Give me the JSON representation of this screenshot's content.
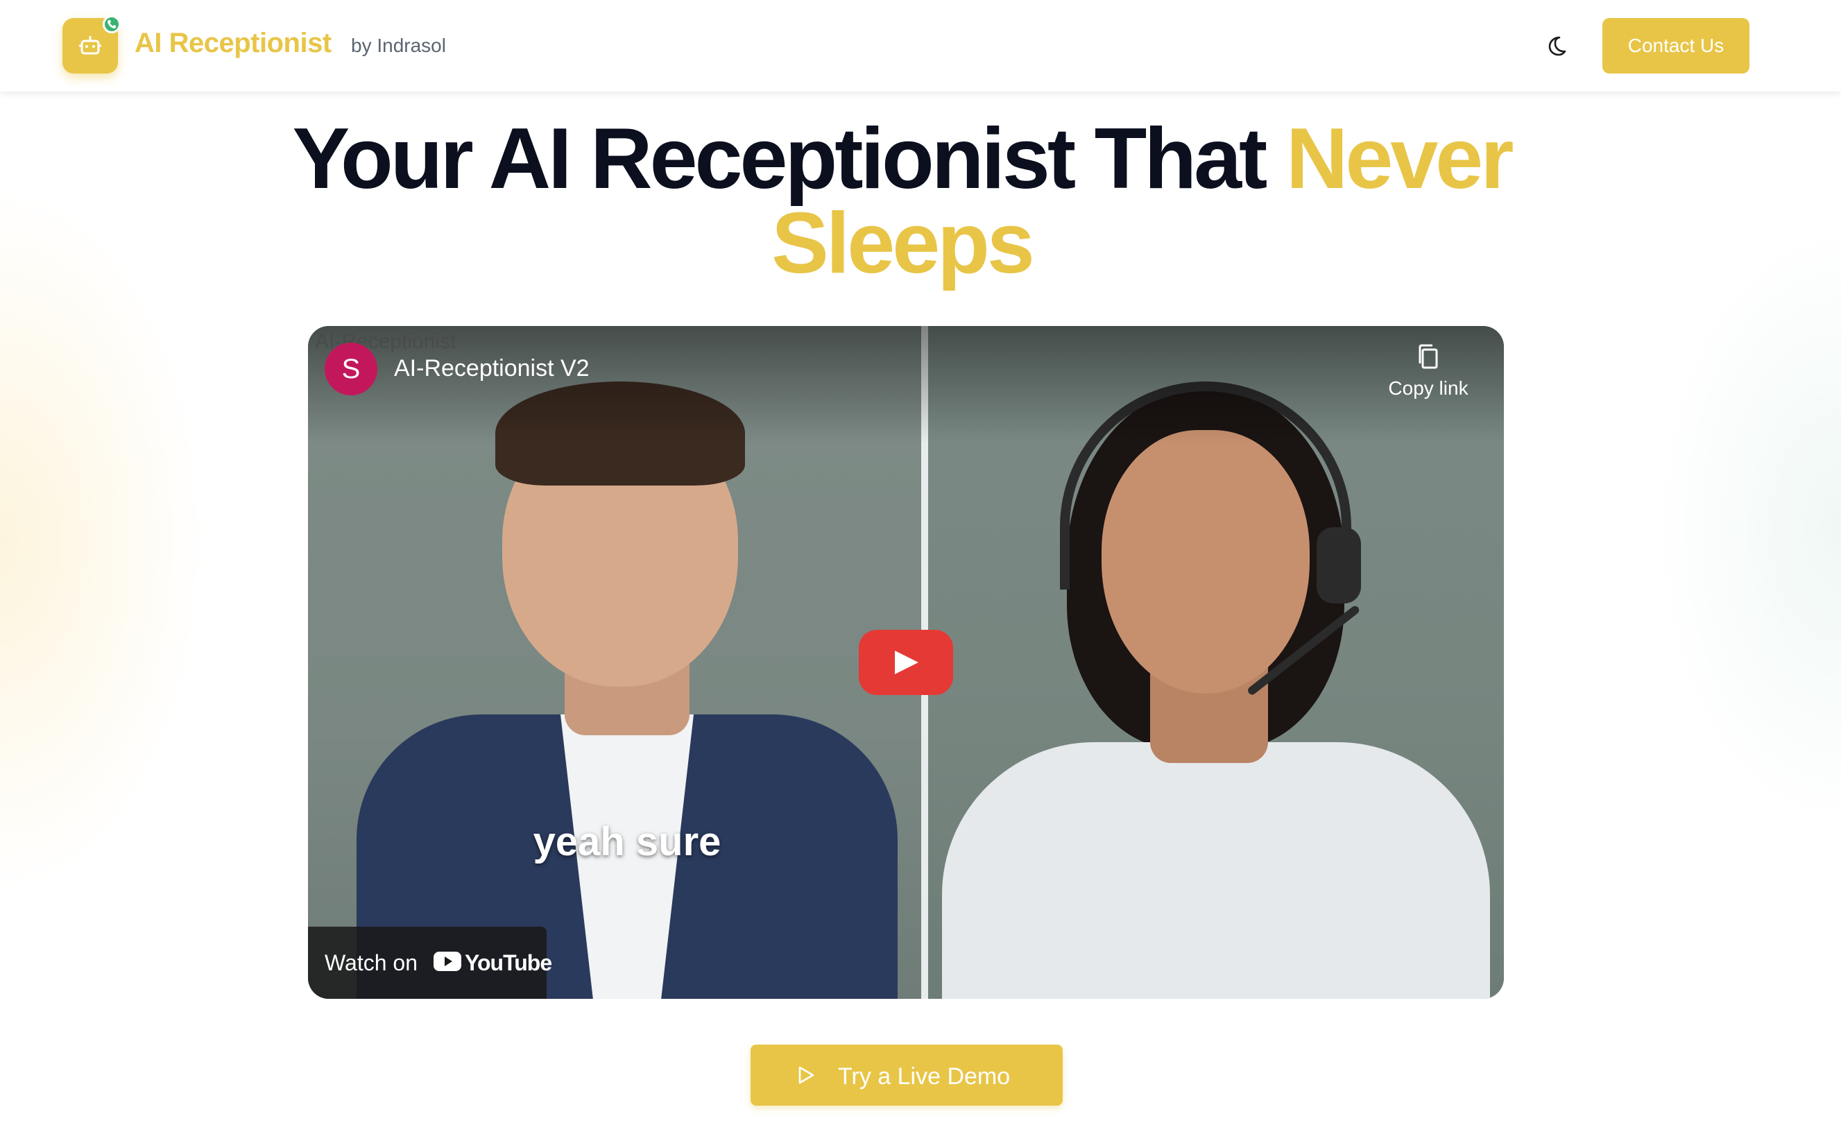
{
  "header": {
    "brand_name": "AI Receptionist",
    "brand_by": "by Indrasol",
    "logo_icon": "robot-icon",
    "status_icon": "phone-icon",
    "theme_toggle_icon": "moon-icon",
    "contact_label": "Contact Us"
  },
  "hero": {
    "headline_main": "Your AI Receptionist That ",
    "headline_accent": "Never Sleeps"
  },
  "video": {
    "watermark": "AI-Receptionist",
    "channel_initial": "S",
    "title": "AI-Receptionist V2",
    "copy_link_label": "Copy link",
    "caption": "yeah sure",
    "watch_on_label": "Watch on",
    "platform_label": "YouTube"
  },
  "cta": {
    "demo_label": "Try a Live Demo"
  },
  "colors": {
    "accent": "#e8c547",
    "headline": "#0b0f1e",
    "play_button": "#e53935",
    "channel_avatar": "#c2185b"
  }
}
